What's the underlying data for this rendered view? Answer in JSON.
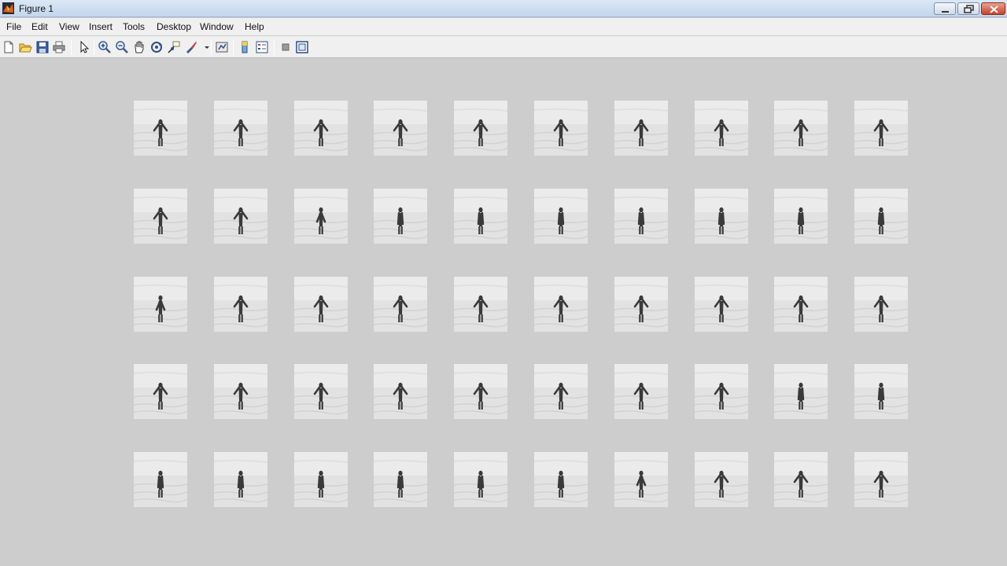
{
  "window": {
    "title": "Figure 1"
  },
  "menu": {
    "items": [
      "File",
      "Edit",
      "View",
      "Insert",
      "Tools",
      "Desktop",
      "Window",
      "Help"
    ]
  },
  "toolbar": {
    "buttons": [
      "new-figure-icon",
      "open-file-icon",
      "save-icon",
      "print-icon",
      "edit-plot-icon",
      "zoom-in-icon",
      "zoom-out-icon",
      "pan-icon",
      "rotate-3d-icon",
      "data-cursor-icon",
      "brush-icon",
      "link-plot-icon",
      "colorbar-icon",
      "legend-icon",
      "hide-plot-tools-icon",
      "show-plot-tools-icon"
    ]
  },
  "figure": {
    "grid": {
      "rows": 5,
      "columns": 10
    },
    "frames": [
      "arms-out",
      "arms-out",
      "arms-out",
      "arms-out",
      "arms-out",
      "arms-out",
      "arms-out",
      "arms-out",
      "arms-out",
      "arms-out",
      "arms-out",
      "arms-out",
      "arms-mid",
      "arms-down",
      "arms-down",
      "arms-down",
      "arms-down",
      "arms-down",
      "arms-down",
      "arms-down",
      "arms-mid",
      "arms-out",
      "arms-out",
      "arms-out",
      "arms-out",
      "arms-out",
      "arms-out",
      "arms-out",
      "arms-out",
      "arms-out",
      "arms-out",
      "arms-out",
      "arms-out",
      "arms-out",
      "arms-out",
      "arms-out",
      "arms-out",
      "arms-out",
      "arms-down",
      "arms-down",
      "arms-down",
      "arms-down",
      "arms-down",
      "arms-down",
      "arms-down",
      "arms-down",
      "arms-mid",
      "arms-out",
      "arms-out",
      "arms-out"
    ]
  },
  "colors": {
    "background": "#cdcdcd",
    "thumbnail": "#ebebeb",
    "figure": "#3a3a3a"
  }
}
